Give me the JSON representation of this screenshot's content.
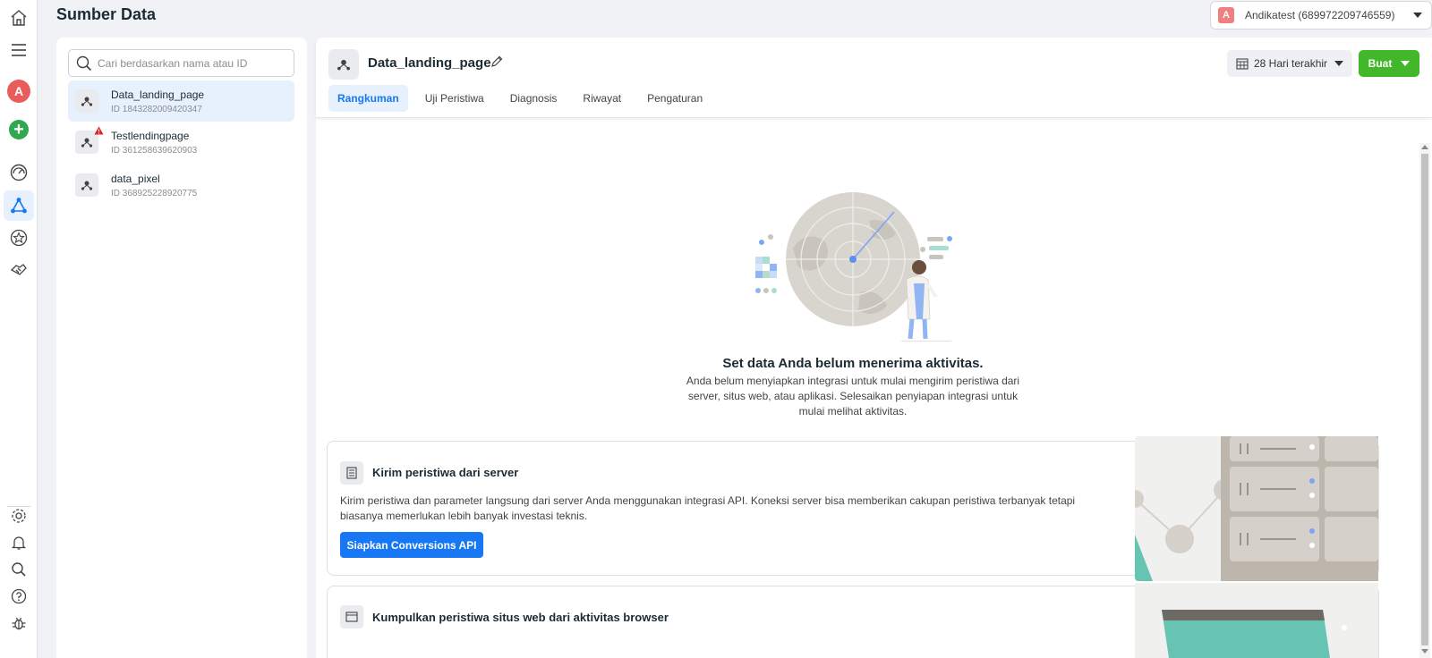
{
  "header": {
    "page_title": "Sumber Data",
    "account_badge": "A",
    "account_name": "Andikatest (689972209746559)"
  },
  "rail": {
    "avatar_letter": "A",
    "plus_symbol": "+",
    "icons": [
      "home-icon",
      "menu-icon",
      "avatar",
      "add-icon",
      "dashboard-icon",
      "data-sources-icon",
      "star-icon",
      "handshake-icon",
      "settings-icon",
      "bell-icon",
      "search-icon",
      "help-icon",
      "bug-icon"
    ]
  },
  "left_panel": {
    "search_placeholder": "Cari berdasarkan nama atau ID",
    "items": [
      {
        "name": "Data_landing_page",
        "id": "ID 1843282009420347",
        "warning": false
      },
      {
        "name": "Testlendingpage",
        "id": "ID 361258639620903",
        "warning": true
      },
      {
        "name": "data_pixel",
        "id": "ID 368925228920775",
        "warning": false
      }
    ]
  },
  "main": {
    "title": "Data_landing_page",
    "tabs": [
      {
        "label": "Rangkuman"
      },
      {
        "label": "Uji Peristiwa"
      },
      {
        "label": "Diagnosis"
      },
      {
        "label": "Riwayat"
      },
      {
        "label": "Pengaturan"
      }
    ],
    "date_range": "28 Hari terakhir",
    "create_label": "Buat",
    "empty_title": "Set data Anda belum menerima aktivitas.",
    "empty_desc": "Anda belum menyiapkan integrasi untuk mulai mengirim peristiwa dari server, situs web, atau aplikasi. Selesaikan penyiapan integrasi untuk mulai melihat aktivitas.",
    "cards": [
      {
        "title": "Kirim peristiwa dari server",
        "desc": "Kirim peristiwa dan parameter langsung dari server Anda menggunakan integrasi API. Koneksi server bisa memberikan cakupan peristiwa terbanyak tetapi biasanya memerlukan lebih banyak investasi teknis.",
        "button": "Siapkan Conversions API"
      },
      {
        "title": "Kumpulkan peristiwa situs web dari aktivitas browser"
      }
    ]
  },
  "colors": {
    "primary": "#1877f2",
    "create": "#42b72a",
    "avatar": "#ea5c5c",
    "warning": "#e02020"
  }
}
